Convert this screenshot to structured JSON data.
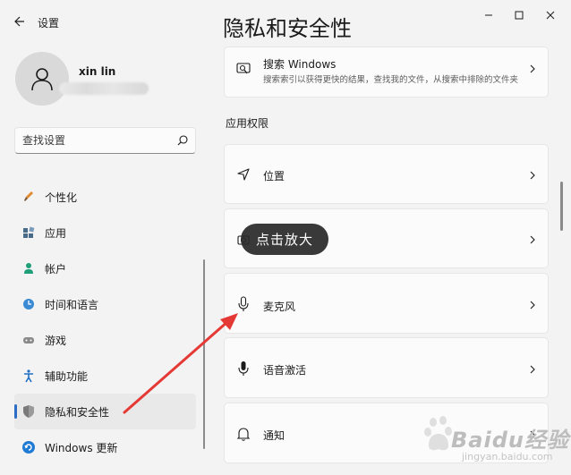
{
  "window": {
    "title": "设置"
  },
  "user": {
    "name": "xin lin"
  },
  "search": {
    "placeholder": "查找设置"
  },
  "sidebar": {
    "items": [
      {
        "label": "个性化"
      },
      {
        "label": "应用"
      },
      {
        "label": "帐户"
      },
      {
        "label": "时间和语言"
      },
      {
        "label": "游戏"
      },
      {
        "label": "辅助功能"
      },
      {
        "label": "隐私和安全性"
      },
      {
        "label": "Windows 更新"
      }
    ]
  },
  "main": {
    "title": "隐私和安全性",
    "search_windows": {
      "title": "搜索 Windows",
      "desc": "搜索索引以获得更快的结果，查找我的文件，从搜索中排除的文件夹"
    },
    "section": "应用权限",
    "rows": [
      {
        "label": "位置"
      },
      {
        "label": "麦克风"
      },
      {
        "label": "语音激活"
      },
      {
        "label": "通知"
      }
    ]
  },
  "overlay": {
    "zoom_label": "点击放大"
  },
  "watermark": {
    "brand": "Baidu经验",
    "sub": "jingyan.baidu.com"
  },
  "colors": {
    "accent": "#2b6cc4",
    "arrow": "#e53935",
    "background": "#f3f3f3",
    "card": "#fbfbfb"
  }
}
